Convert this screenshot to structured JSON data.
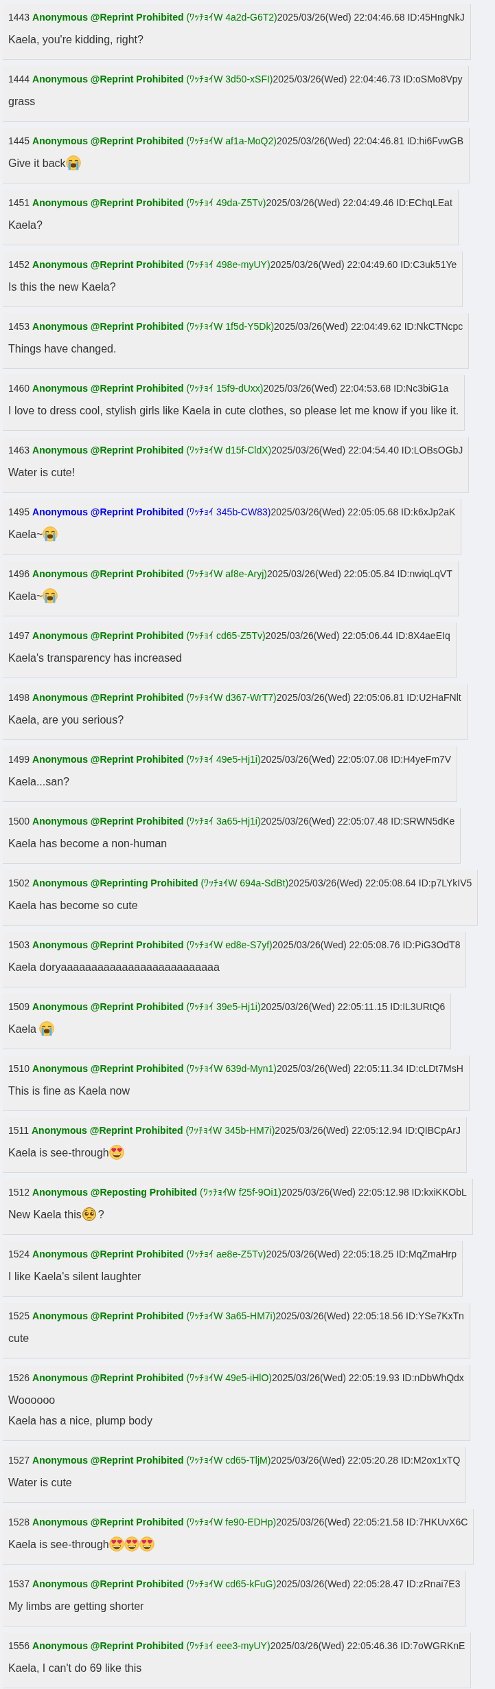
{
  "posts": [
    {
      "number": "1443",
      "name": "Anonymous @Reprint Prohibited",
      "tag": "(ﾜｯﾁｮｲW 4a2d-G6T2)",
      "date": "2025/03/26(Wed) 22:04:46.68",
      "id": "ID:45HngNkJ",
      "color": "#008000",
      "lines": [
        [
          {
            "kind": "text",
            "text": "Kaela, you're kidding, right?"
          }
        ]
      ]
    },
    {
      "number": "1444",
      "name": "Anonymous @Reprint Prohibited",
      "tag": "(ﾜｯﾁｮｲW 3d50-xSFI)",
      "date": "2025/03/26(Wed) 22:04:46.73",
      "id": "ID:oSMo8Vpy",
      "color": "#008000",
      "lines": [
        [
          {
            "kind": "text",
            "text": "grass"
          }
        ]
      ]
    },
    {
      "number": "1445",
      "name": "Anonymous @Reprint Prohibited",
      "tag": "(ﾜｯﾁｮｲW af1a-MoQ2)",
      "date": "2025/03/26(Wed) 22:04:46.81",
      "id": "ID:hi6FvwGB",
      "color": "#008000",
      "lines": [
        [
          {
            "kind": "text",
            "text": "Give it back"
          },
          {
            "kind": "crying"
          }
        ]
      ]
    },
    {
      "number": "1451",
      "name": "Anonymous @Reprint Prohibited",
      "tag": "(ﾜｯﾁｮｲ 49da-Z5Tv)",
      "date": "2025/03/26(Wed) 22:04:49.46",
      "id": "ID:EChqLEat",
      "color": "#008000",
      "lines": [
        [
          {
            "kind": "text",
            "text": "Kaela?"
          }
        ]
      ]
    },
    {
      "number": "1452",
      "name": "Anonymous @Reprint Prohibited",
      "tag": "(ﾜｯﾁｮｲ 498e-myUY)",
      "date": "2025/03/26(Wed) 22:04:49.60",
      "id": "ID:C3uk51Ye",
      "color": "#008000",
      "lines": [
        [
          {
            "kind": "text",
            "text": "Is this the new Kaela?"
          }
        ]
      ]
    },
    {
      "number": "1453",
      "name": "Anonymous @Reprint Prohibited",
      "tag": "(ﾜｯﾁｮｲW 1f5d-Y5Dk)",
      "date": "2025/03/26(Wed) 22:04:49.62",
      "id": "ID:NkCTNcpc",
      "color": "#008000",
      "lines": [
        [
          {
            "kind": "text",
            "text": "Things have changed."
          }
        ]
      ]
    },
    {
      "number": "1460",
      "name": "Anonymous @Reprint Prohibited",
      "tag": "(ﾜｯﾁｮｲ 15f9-dUxx)",
      "date": "2025/03/26(Wed) 22:04:53.68",
      "id": "ID:Nc3biG1a",
      "color": "#008000",
      "lines": [
        [
          {
            "kind": "text",
            "text": "I love to dress cool, stylish girls like Kaela in cute clothes, so please let me know if you like it."
          }
        ]
      ]
    },
    {
      "number": "1463",
      "name": "Anonymous @Reprint Prohibited",
      "tag": "(ﾜｯﾁｮｲW d15f-CldX)",
      "date": "2025/03/26(Wed) 22:04:54.40",
      "id": "ID:LOBsOGbJ",
      "color": "#008000",
      "lines": [
        [
          {
            "kind": "text",
            "text": "Water is cute!"
          }
        ]
      ]
    },
    {
      "number": "1495",
      "name": "Anonymous @Reprint Prohibited",
      "tag": "(ﾜｯﾁｮｲ 345b-CW83)",
      "date": "2025/03/26(Wed) 22:05:05.68",
      "id": "ID:k6xJp2aK",
      "color": "#0000ff",
      "lines": [
        [
          {
            "kind": "text",
            "text": "Kaela~"
          },
          {
            "kind": "crying"
          }
        ]
      ]
    },
    {
      "number": "1496",
      "name": "Anonymous @Reprint Prohibited",
      "tag": "(ﾜｯﾁｮｲW af8e-Aryj)",
      "date": "2025/03/26(Wed) 22:05:05.84",
      "id": "ID:nwiqLqVT",
      "color": "#008000",
      "lines": [
        [
          {
            "kind": "text",
            "text": "Kaela~"
          },
          {
            "kind": "crying"
          }
        ]
      ]
    },
    {
      "number": "1497",
      "name": "Anonymous @Reprint Prohibited",
      "tag": "(ﾜｯﾁｮｲ cd65-Z5Tv)",
      "date": "2025/03/26(Wed) 22:05:06.44",
      "id": "ID:8X4aeEIq",
      "color": "#008000",
      "lines": [
        [
          {
            "kind": "text",
            "text": "Kaela's transparency has increased"
          }
        ]
      ]
    },
    {
      "number": "1498",
      "name": "Anonymous @Reprint Prohibited",
      "tag": "(ﾜｯﾁｮｲW d367-WrT7)",
      "date": "2025/03/26(Wed) 22:05:06.81",
      "id": "ID:U2HaFNlt",
      "color": "#008000",
      "lines": [
        [
          {
            "kind": "text",
            "text": "Kaela, are you serious?"
          }
        ]
      ]
    },
    {
      "number": "1499",
      "name": "Anonymous @Reprint Prohibited",
      "tag": "(ﾜｯﾁｮｲ 49e5-Hj1i)",
      "date": "2025/03/26(Wed) 22:05:07.08",
      "id": "ID:H4yeFm7V",
      "color": "#008000",
      "lines": [
        [
          {
            "kind": "text",
            "text": "Kaela...san?"
          }
        ]
      ]
    },
    {
      "number": "1500",
      "name": "Anonymous @Reprint Prohibited",
      "tag": "(ﾜｯﾁｮｲ 3a65-Hj1i)",
      "date": "2025/03/26(Wed) 22:05:07.48",
      "id": "ID:SRWN5dKe",
      "color": "#008000",
      "lines": [
        [
          {
            "kind": "text",
            "text": "Kaela has become a non-human"
          }
        ]
      ]
    },
    {
      "number": "1502",
      "name": "Anonymous @Reprinting Prohibited",
      "tag": "(ﾜｯﾁｮｲW 694a-SdBt)",
      "date": "2025/03/26(Wed) 22:05:08.64",
      "id": "ID:p7LYkIV5",
      "color": "#008000",
      "lines": [
        [
          {
            "kind": "text",
            "text": "Kaela has become so cute"
          }
        ]
      ]
    },
    {
      "number": "1503",
      "name": "Anonymous @Reprint Prohibited",
      "tag": "(ﾜｯﾁｮｲW ed8e-S7yf)",
      "date": "2025/03/26(Wed) 22:05:08.76",
      "id": "ID:PiG3OdT8",
      "color": "#008000",
      "lines": [
        [
          {
            "kind": "text",
            "text": "Kaela doryaaaaaaaaaaaaaaaaaaaaaaaaaa"
          }
        ]
      ]
    },
    {
      "number": "1509",
      "name": "Anonymous @Reprint Prohibited",
      "tag": "(ﾜｯﾁｮｲ 39e5-Hj1i)",
      "date": "2025/03/26(Wed) 22:05:11.15",
      "id": "ID:IL3URtQ6",
      "color": "#008000",
      "lines": [
        [
          {
            "kind": "text",
            "text": "Kaela "
          },
          {
            "kind": "crying"
          }
        ]
      ]
    },
    {
      "number": "1510",
      "name": "Anonymous @Reprint Prohibited",
      "tag": "(ﾜｯﾁｮｲW 639d-Myn1)",
      "date": "2025/03/26(Wed) 22:05:11.34",
      "id": "ID:cLDt7MsH",
      "color": "#008000",
      "lines": [
        [
          {
            "kind": "text",
            "text": "This is fine as Kaela now"
          }
        ]
      ]
    },
    {
      "number": "1511",
      "name": "Anonymous @Reprint Prohibited",
      "tag": "(ﾜｯﾁｮｲW 345b-HM7i)",
      "date": "2025/03/26(Wed) 22:05:12.94",
      "id": "ID:QIBCpArJ",
      "color": "#008000",
      "lines": [
        [
          {
            "kind": "text",
            "text": "Kaela is see-through"
          },
          {
            "kind": "hearteyes"
          }
        ]
      ]
    },
    {
      "number": "1512",
      "name": "Anonymous @Reposting Prohibited",
      "tag": "(ﾜｯﾁｮｲW f25f-9Oi1)",
      "date": "2025/03/26(Wed) 22:05:12.98",
      "id": "ID:kxiKKObL",
      "color": "#008000",
      "lines": [
        [
          {
            "kind": "text",
            "text": "New Kaela this"
          },
          {
            "kind": "pleading"
          },
          {
            "kind": "text",
            "text": "?"
          }
        ]
      ]
    },
    {
      "number": "1524",
      "name": "Anonymous @Reprint Prohibited",
      "tag": "(ﾜｯﾁｮｲ ae8e-Z5Tv)",
      "date": "2025/03/26(Wed) 22:05:18.25",
      "id": "ID:MqZmaHrp",
      "color": "#008000",
      "lines": [
        [
          {
            "kind": "text",
            "text": "I like Kaela's silent laughter"
          }
        ]
      ]
    },
    {
      "number": "1525",
      "name": "Anonymous @Reprint Prohibited",
      "tag": "(ﾜｯﾁｮｲW 3a65-HM7i)",
      "date": "2025/03/26(Wed) 22:05:18.56",
      "id": "ID:YSe7KxTn",
      "color": "#008000",
      "lines": [
        [
          {
            "kind": "text",
            "text": "cute"
          }
        ]
      ]
    },
    {
      "number": "1526",
      "name": "Anonymous @Reprint Prohibited",
      "tag": "(ﾜｯﾁｮｲW 49e5-iHlO)",
      "date": "2025/03/26(Wed) 22:05:19.93",
      "id": "ID:nDbWhQdx",
      "color": "#008000",
      "lines": [
        [
          {
            "kind": "text",
            "text": "Woooooo"
          }
        ],
        [
          {
            "kind": "text",
            "text": "Kaela has a nice, plump body"
          }
        ]
      ]
    },
    {
      "number": "1527",
      "name": "Anonymous @Reprint Prohibited",
      "tag": "(ﾜｯﾁｮｲW cd65-TljM)",
      "date": "2025/03/26(Wed) 22:05:20.28",
      "id": "ID:M2ox1xTQ",
      "color": "#008000",
      "lines": [
        [
          {
            "kind": "text",
            "text": "Water is cute"
          }
        ]
      ]
    },
    {
      "number": "1528",
      "name": "Anonymous @Reprint Prohibited",
      "tag": "(ﾜｯﾁｮｲW fe90-EDHp)",
      "date": "2025/03/26(Wed) 22:05:21.58",
      "id": "ID:7HKUvX6C",
      "color": "#008000",
      "lines": [
        [
          {
            "kind": "text",
            "text": "Kaela is see-through"
          },
          {
            "kind": "hearteyes"
          },
          {
            "kind": "hearteyes"
          },
          {
            "kind": "hearteyes"
          }
        ]
      ]
    },
    {
      "number": "1537",
      "name": "Anonymous @Reprint Prohibited",
      "tag": "(ﾜｯﾁｮｲW cd65-kFuG)",
      "date": "2025/03/26(Wed) 22:05:28.47",
      "id": "ID:zRnai7E3",
      "color": "#008000",
      "lines": [
        [
          {
            "kind": "text",
            "text": "My limbs are getting shorter"
          }
        ]
      ]
    },
    {
      "number": "1556",
      "name": "Anonymous @Reprint Prohibited",
      "tag": "(ﾜｯﾁｮｲ eee3-myUY)",
      "date": "2025/03/26(Wed) 22:05:46.36",
      "id": "ID:7oWGRKnE",
      "color": "#008000",
      "lines": [
        [
          {
            "kind": "text",
            "text": "Kaela, I can't do 69 like this"
          }
        ]
      ]
    }
  ]
}
